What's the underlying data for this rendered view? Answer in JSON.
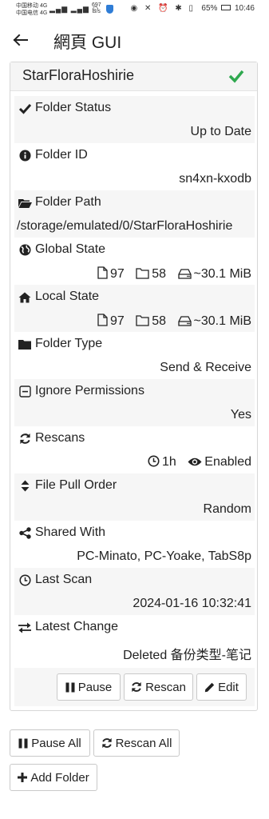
{
  "status_bar": {
    "carrier1": "中国移动",
    "carrier2": "中国电信",
    "net1": "4G",
    "net2": "4G",
    "speed_value": "697",
    "speed_unit": "B/s",
    "battery": "65%",
    "time": "10:46"
  },
  "app_bar": {
    "title": "網頁 GUI"
  },
  "folder": {
    "name": "StarFloraHoshirie",
    "status_ok": true,
    "rows": [
      {
        "label": "Folder Status",
        "icon": "check-icon",
        "value": "Up to Date"
      },
      {
        "label": "Folder ID",
        "icon": "info-circle-icon",
        "value": "sn4xn-kxodb"
      },
      {
        "label": "Folder Path",
        "icon": "folder-open-icon",
        "value": "/storage/emulated/0/StarFloraHoshirie"
      },
      {
        "label": "Global State",
        "icon": "globe-icon",
        "files": "97",
        "dirs": "58",
        "size": "~30.1 MiB"
      },
      {
        "label": "Local State",
        "icon": "home-icon",
        "files": "97",
        "dirs": "58",
        "size": "~30.1 MiB"
      },
      {
        "label": "Folder Type",
        "icon": "folder-icon",
        "value": "Send & Receive"
      },
      {
        "label": "Ignore Permissions",
        "icon": "minus-square-icon",
        "value": "Yes"
      },
      {
        "label": "Rescans",
        "icon": "refresh-icon",
        "interval": "1h",
        "watch": "Enabled"
      },
      {
        "label": "File Pull Order",
        "icon": "sort-icon",
        "value": "Random"
      },
      {
        "label": "Shared With",
        "icon": "share-icon",
        "value": "PC-Minato, PC-Yoake, TabS8p"
      },
      {
        "label": "Last Scan",
        "icon": "clock-icon",
        "value": "2024-01-16 10:32:41"
      },
      {
        "label": "Latest Change",
        "icon": "exchange-icon",
        "value": "Deleted 备份类型-笔记"
      }
    ],
    "buttons": {
      "pause": "Pause",
      "rescan": "Rescan",
      "edit": "Edit"
    }
  },
  "global_buttons": {
    "pause_all": "Pause All",
    "rescan_all": "Rescan All",
    "add_folder": "Add Folder"
  },
  "colors": {
    "ok_green": "#2fa84f",
    "row_shade": "#f6f6f6",
    "header_bg": "#f5f5f5"
  }
}
